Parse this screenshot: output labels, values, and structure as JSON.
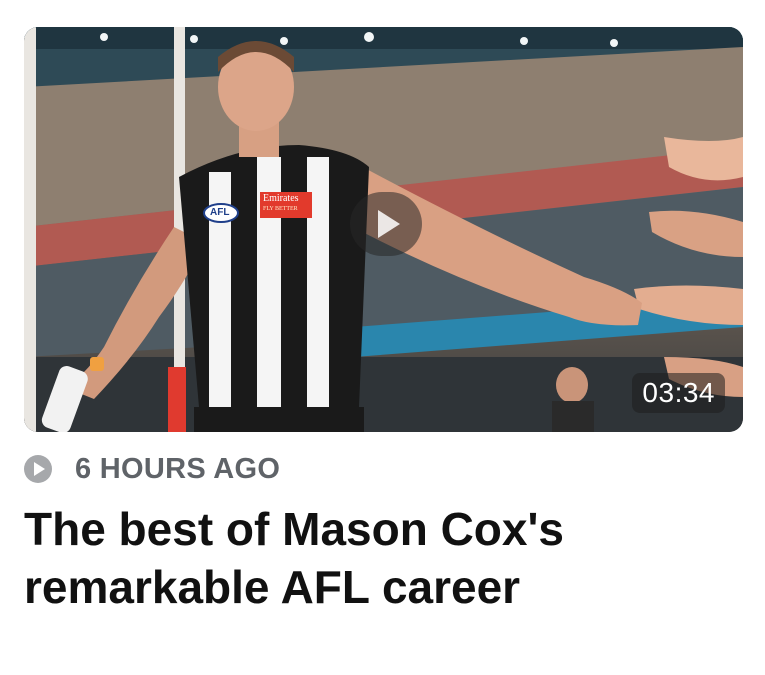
{
  "article": {
    "thumbnail_alt": "Mason Cox high-fiving fans at the MCG",
    "duration": "03:34",
    "jersey_sponsor": "Emirates",
    "jersey_sponsor_tagline": "FLY BETTER",
    "league_badge": "AFL",
    "timestamp": "6 HOURS AGO",
    "title": "The best of Mason Cox's remarkable AFL career"
  },
  "icons": {
    "play_overlay": "play-icon",
    "meta": "play-circle-icon"
  },
  "colors": {
    "meta_text": "#5f6368",
    "title_text": "#111111",
    "sponsor_red": "#e23a2c"
  }
}
